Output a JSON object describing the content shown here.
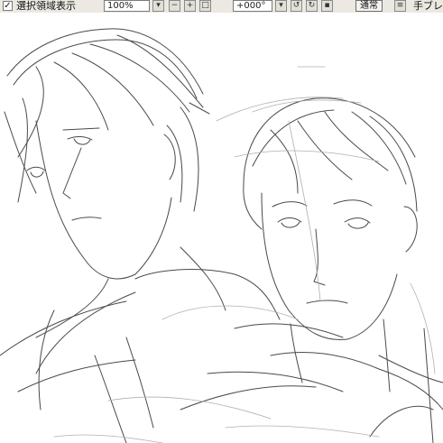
{
  "toolbar": {
    "selection_label": "選択領域表示",
    "selection_checked": true,
    "check_icon": "check-icon",
    "zoom_value": "100%",
    "angle_value": "+000°",
    "blend_mode": "通常",
    "tool_label": "手ブレ",
    "icons": [
      "dropdown-icon",
      "zoom-out-icon",
      "zoom-in-icon",
      "fit-icon",
      "rotate-left-icon",
      "rotate-right-icon",
      "reset-icon",
      "layer-icon"
    ]
  },
  "canvas": {
    "content": "pencil sketch of two young men",
    "stroke_color": "#555555",
    "background": "#ffffff"
  }
}
